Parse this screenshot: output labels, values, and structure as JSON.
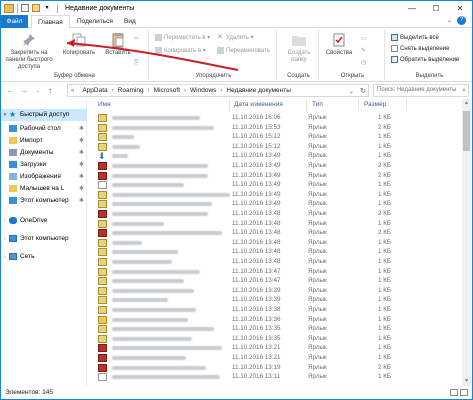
{
  "window": {
    "title": "Недавние документы",
    "controls": {
      "minimize": "—",
      "maximize": "☐",
      "close": "✕"
    }
  },
  "tabs": [
    "Файл",
    "Главная",
    "Поделиться",
    "Вид"
  ],
  "ribbon": {
    "clipboard": {
      "pin": "Закрепить на панели быстрого доступа",
      "copy": "Копировать",
      "paste": "Вставить",
      "group": "Буфер обмена"
    },
    "organize": {
      "move_to": "Переместить в ▾",
      "copy_to": "Копировать в ▾",
      "delete": "Удалить ▾",
      "rename": "Переименовать",
      "group": "Упорядочить"
    },
    "create": {
      "new_folder": "Создать папку",
      "group": "Создать"
    },
    "open": {
      "properties": "Свойства",
      "group": "Открыть"
    },
    "select": {
      "select_all": "Выделить все",
      "select_none": "Снять выделение",
      "invert": "Обратить выделение",
      "group": "Выделить"
    }
  },
  "address": {
    "crumbs": [
      "AppData",
      "Roaming",
      "Microsoft",
      "Windows",
      "Недавние документы"
    ],
    "search_placeholder": "Поиск: Недавние документы"
  },
  "nav": {
    "quick_access": "Быстрый доступ",
    "items": [
      {
        "label": "Рабочий стол",
        "pinned": true
      },
      {
        "label": "Импорт",
        "pinned": true
      },
      {
        "label": "Документы",
        "pinned": true
      },
      {
        "label": "Загрузки",
        "pinned": true
      },
      {
        "label": "Изображения",
        "pinned": true
      },
      {
        "label": "Малышев на L",
        "pinned": true
      },
      {
        "label": "Этот компьютер",
        "pinned": true
      }
    ],
    "onedrive": "OneDrive",
    "this_pc": "Этот компьютер",
    "network": "Сеть"
  },
  "columns": {
    "name": "Имя",
    "date": "Дата изменения",
    "type": "Тип",
    "size": "Размер"
  },
  "files": [
    {
      "date": "11.10.2016 16:06",
      "type": "Ярлык",
      "size": "1 КБ",
      "icon": "shortcut-doc"
    },
    {
      "date": "11.10.2016 15:53",
      "type": "Ярлык",
      "size": "2 КБ",
      "icon": "shortcut-doc"
    },
    {
      "date": "11.10.2016 15:12",
      "type": "Ярлык",
      "size": "1 КБ",
      "icon": "shortcut-doc"
    },
    {
      "date": "11.10.2016 15:12",
      "type": "Ярлык",
      "size": "1 КБ",
      "icon": "shortcut-doc"
    },
    {
      "date": "11.10.2016 13:49",
      "type": "Ярлык",
      "size": "1 КБ",
      "icon": "download-arrow"
    },
    {
      "date": "11.10.2016 13:49",
      "type": "Ярлык",
      "size": "2 КБ",
      "icon": "shortcut-pdf"
    },
    {
      "date": "11.10.2016 13:49",
      "type": "Ярлык",
      "size": "2 КБ",
      "icon": "shortcut-pdf"
    },
    {
      "date": "11.10.2016 13:49",
      "type": "Ярлык",
      "size": "1 КБ",
      "icon": "shortcut-blank"
    },
    {
      "date": "11.10.2016 13:49",
      "type": "Ярлык",
      "size": "1 КБ",
      "icon": "shortcut-doc"
    },
    {
      "date": "11.10.2016 13:49",
      "type": "Ярлык",
      "size": "1 КБ",
      "icon": "shortcut-doc"
    },
    {
      "date": "11.10.2016 13:48",
      "type": "Ярлык",
      "size": "2 КБ",
      "icon": "shortcut-pdf"
    },
    {
      "date": "11.10.2016 13:48",
      "type": "Ярлык",
      "size": "1 КБ",
      "icon": "shortcut-doc"
    },
    {
      "date": "11.10.2016 13:48",
      "type": "Ярлык",
      "size": "2 КБ",
      "icon": "shortcut-pdf"
    },
    {
      "date": "11.10.2016 13:48",
      "type": "Ярлык",
      "size": "1 КБ",
      "icon": "shortcut-doc"
    },
    {
      "date": "11.10.2016 13:48",
      "type": "Ярлык",
      "size": "1 КБ",
      "icon": "shortcut-doc"
    },
    {
      "date": "11.10.2016 13:48",
      "type": "Ярлык",
      "size": "1 КБ",
      "icon": "shortcut-doc"
    },
    {
      "date": "11.10.2016 13:47",
      "type": "Ярлык",
      "size": "1 КБ",
      "icon": "shortcut-doc"
    },
    {
      "date": "11.10.2016 13:47",
      "type": "Ярлык",
      "size": "1 КБ",
      "icon": "shortcut-doc"
    },
    {
      "date": "11.10.2016 13:39",
      "type": "Ярлык",
      "size": "1 КБ",
      "icon": "shortcut-doc"
    },
    {
      "date": "11.10.2016 13:39",
      "type": "Ярлык",
      "size": "1 КБ",
      "icon": "shortcut-doc"
    },
    {
      "date": "11.10.2016 13:38",
      "type": "Ярлык",
      "size": "1 КБ",
      "icon": "shortcut-doc"
    },
    {
      "date": "11.10.2016 13:36",
      "type": "Ярлык",
      "size": "1 КБ",
      "icon": "folder"
    },
    {
      "date": "11.10.2016 13:35",
      "type": "Ярлык",
      "size": "1 КБ",
      "icon": "shortcut-doc"
    },
    {
      "date": "11.10.2016 13:35",
      "type": "Ярлык",
      "size": "1 КБ",
      "icon": "shortcut-doc"
    },
    {
      "date": "11.10.2016 13:21",
      "type": "Ярлык",
      "size": "1 КБ",
      "icon": "shortcut-pdf"
    },
    {
      "date": "11.10.2016 13:21",
      "type": "Ярлык",
      "size": "1 КБ",
      "icon": "shortcut-pdf"
    },
    {
      "date": "11.10.2016 13:19",
      "type": "Ярлык",
      "size": "2 КБ",
      "icon": "shortcut-pdf"
    },
    {
      "date": "11.10.2016 13:11",
      "type": "Ярлык",
      "size": "1 КБ",
      "icon": "shortcut-blank"
    }
  ],
  "status": {
    "count": "Элементов: 145"
  },
  "colors": {
    "accent": "#1979ca",
    "arrow": "#c8202a",
    "selection": "#cce8ff"
  }
}
